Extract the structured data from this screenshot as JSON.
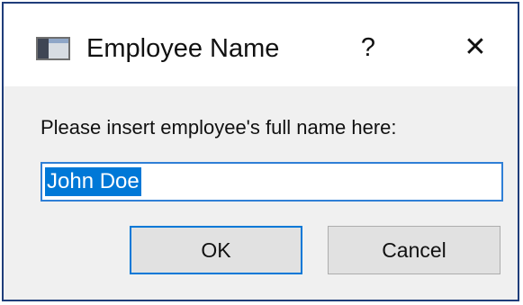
{
  "window": {
    "title": "Employee Name",
    "help_label": "?",
    "close_label": "✕"
  },
  "dialog": {
    "prompt": "Please insert employee's full name here:",
    "name_value": "John Doe",
    "ok_label": "OK",
    "cancel_label": "Cancel"
  },
  "icons": {
    "app": "application-window-icon",
    "help": "question-mark-icon",
    "close": "close-icon"
  },
  "colors": {
    "accent": "#0078d7",
    "window_border": "#1f3d7a",
    "dialog_background": "#f0f0f0"
  }
}
